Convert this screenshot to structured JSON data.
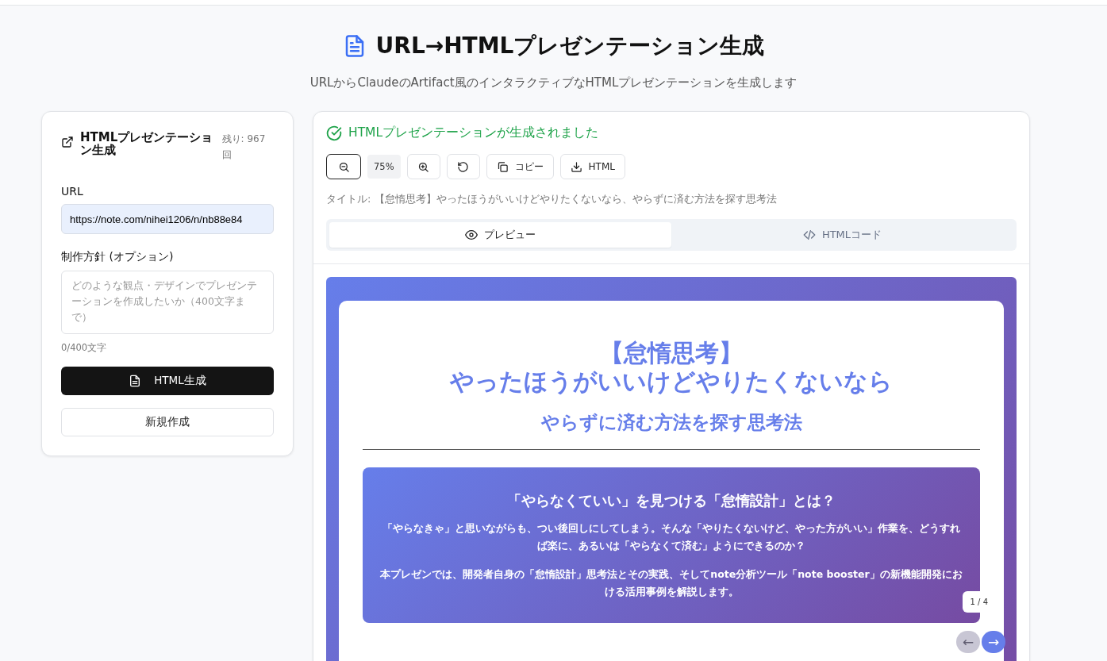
{
  "header": {
    "title": "URL→HTMLプレゼンテーション生成",
    "subtitle": "URLからClaudeのArtifact風のインタラクティブなHTMLプレゼンテーションを生成します"
  },
  "form": {
    "title": "HTMLプレゼンテーション生成",
    "remaining": "残り: 967回",
    "url_label": "URL",
    "url_value": "https://note.com/nihei1206/n/nb88e84",
    "policy_label": "制作方針 (オプション)",
    "policy_placeholder": "どのような観点・デザインでプレゼンテーションを作成したいか（400文字まで）",
    "counter": "0/400文字",
    "generate_button": "HTML生成",
    "new_button": "新規作成"
  },
  "result": {
    "status": "HTMLプレゼンテーションが生成されました",
    "zoom": "75%",
    "copy_button": "コピー",
    "download_button": "HTML",
    "title_line": "タイトル: 【怠惰思考】やったほうがいいけどやりたくないなら、やらずに済む方法を探す思考法",
    "tabs": [
      {
        "kind": "preview",
        "label": "プレビュー",
        "selected": true
      },
      {
        "kind": "code",
        "label": "HTMLコード",
        "selected": false
      }
    ]
  },
  "slide": {
    "title_lines": [
      "【怠惰思考】",
      "やったほうがいいけどやりたくないなら"
    ],
    "subtitle": "やらずに済む方法を探す思考法",
    "box_heading": "「やらなくていい」を見つける「怠惰設計」とは？",
    "paragraphs": [
      "「やらなきゃ」と思いながらも、つい後回しにしてしまう。そんな「やりたくないけど、やった方がいい」作業を、どうすれば楽に、あるいは「やらなくて済む」ようにできるのか？",
      "本プレゼンでは、開発者自身の「怠惰設計」思考法とその実践、そしてnote分析ツール「note booster」の新機能開発における活用事例を解説します。"
    ],
    "page": "1 / 4",
    "prev": {
      "label": "←",
      "disabled": true
    },
    "next": {
      "label": "→",
      "disabled": false
    }
  }
}
